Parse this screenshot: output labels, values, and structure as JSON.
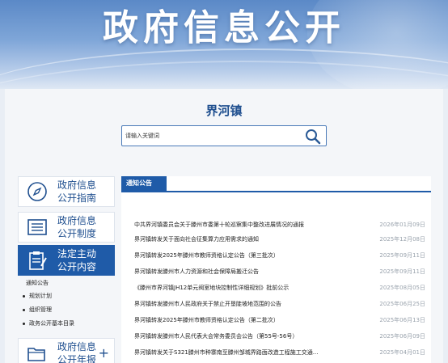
{
  "banner": {
    "title": "政府信息公开"
  },
  "town": {
    "name": "界河镇"
  },
  "search": {
    "placeholder": "请输入关键词"
  },
  "sidebar": {
    "items": [
      {
        "label": "政府信息公开指南",
        "icon": "compass-icon"
      },
      {
        "label": "政府信息公开制度",
        "icon": "list-doc-icon"
      },
      {
        "label": "法定主动公开内容",
        "icon": "clipboard-icon"
      },
      {
        "label": "政府信息公开年报",
        "icon": "folder-icon"
      }
    ],
    "sub_items": [
      "通知公告",
      "规划计划",
      "组织管理",
      "政务公开基本目录"
    ],
    "plus": "+"
  },
  "notice": {
    "tab": "通知公告",
    "rows": [
      {
        "title": "中共界河镇委员会关于滕州市委第十轮巡察集中整改进展情况的通报",
        "date": "2026年01月09日"
      },
      {
        "title": "界河镇转发关于面向社会征集算力应用需求的通知",
        "date": "2025年12月08日"
      },
      {
        "title": "界河镇转发2025年滕州市教师资格认定公告（第三批次）",
        "date": "2025年09月11日"
      },
      {
        "title": "界河镇转发滕州市人力资源和社会保障局搬迁公告",
        "date": "2025年09月11日"
      },
      {
        "title": "《滕州市界河镇JH12单元阀室地块控制性详细规划》批前公示",
        "date": "2025年08月05日"
      },
      {
        "title": "界河镇转发滕州市人民政府关于禁止开垦陡坡地范围的公告",
        "date": "2025年06月25日"
      },
      {
        "title": "界河镇转发2025年滕州市教师资格认定公告（第二批次）",
        "date": "2025年06月13日"
      },
      {
        "title": "界河镇转发滕州市人民代表大会常务委员会公告（第55号-56号）",
        "date": "2025年06月09日"
      },
      {
        "title": "界河镇转发关于S321滕州市种寨南至滕州邹城界路面改造工程施工交通...",
        "date": "2025年04月01日"
      }
    ]
  },
  "colors": {
    "primary": "#1f5ba8",
    "accent_text": "#1f4f8f",
    "date": "#9aa3ad"
  }
}
